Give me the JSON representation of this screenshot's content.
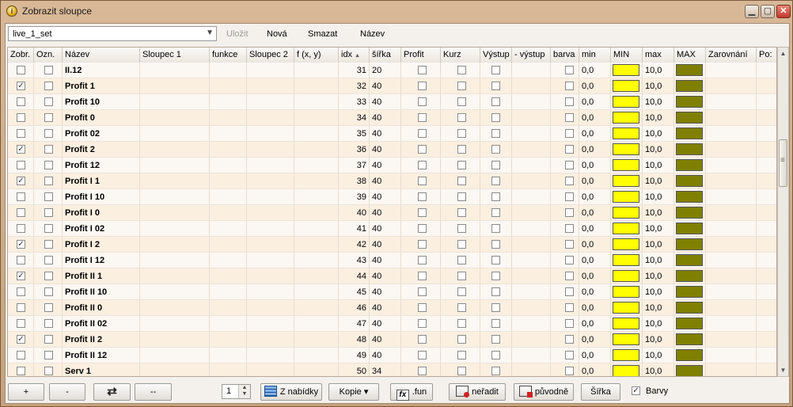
{
  "window": {
    "title": "Zobrazit sloupce",
    "icon": "info-app-icon",
    "controls": {
      "minimize": "▁",
      "maximize": "▢",
      "close": "✕"
    }
  },
  "toolbar": {
    "combo_value": "live_1_set",
    "save_label": "Uložit",
    "new_label": "Nová",
    "delete_label": "Smazat",
    "name_label": "Název"
  },
  "columns": {
    "zobr": "Zobr.",
    "ozn": "Ozn.",
    "nazev": "Název",
    "sloupec1": "Sloupec 1",
    "funkce": "funkce",
    "sloupec2": "Sloupec 2",
    "fxy": "f (x, y)",
    "idx": "idx",
    "sirka": "šířka",
    "profit": "Profit",
    "kurz": "Kurz",
    "vystup": "Výstup",
    "minus_vystup": "- výstup",
    "barva": "barva",
    "min": "min",
    "MIN": "MIN",
    "max": "max",
    "MAX": "MAX",
    "zarovnani": "Zarovnání",
    "poz": "Po:"
  },
  "rows": [
    {
      "zobr": false,
      "ozn": false,
      "nazev": "II.12",
      "idx": "31",
      "sirka": "20",
      "min": "0,0",
      "max": "10,0"
    },
    {
      "zobr": true,
      "ozn": false,
      "nazev": "Profit 1",
      "idx": "32",
      "sirka": "40",
      "min": "0,0",
      "max": "10,0"
    },
    {
      "zobr": false,
      "ozn": false,
      "nazev": "Profit 10",
      "idx": "33",
      "sirka": "40",
      "min": "0,0",
      "max": "10,0"
    },
    {
      "zobr": false,
      "ozn": false,
      "nazev": "Profit 0",
      "idx": "34",
      "sirka": "40",
      "min": "0,0",
      "max": "10,0"
    },
    {
      "zobr": false,
      "ozn": false,
      "nazev": "Profit 02",
      "idx": "35",
      "sirka": "40",
      "min": "0,0",
      "max": "10,0"
    },
    {
      "zobr": true,
      "ozn": false,
      "nazev": "Profit 2",
      "idx": "36",
      "sirka": "40",
      "min": "0,0",
      "max": "10,0"
    },
    {
      "zobr": false,
      "ozn": false,
      "nazev": "Profit 12",
      "idx": "37",
      "sirka": "40",
      "min": "0,0",
      "max": "10,0"
    },
    {
      "zobr": true,
      "ozn": false,
      "nazev": "Profit I 1",
      "idx": "38",
      "sirka": "40",
      "min": "0,0",
      "max": "10,0"
    },
    {
      "zobr": false,
      "ozn": false,
      "nazev": "Profit I 10",
      "idx": "39",
      "sirka": "40",
      "min": "0,0",
      "max": "10,0"
    },
    {
      "zobr": false,
      "ozn": false,
      "nazev": "Profit I 0",
      "idx": "40",
      "sirka": "40",
      "min": "0,0",
      "max": "10,0"
    },
    {
      "zobr": false,
      "ozn": false,
      "nazev": "Profit I 02",
      "idx": "41",
      "sirka": "40",
      "min": "0,0",
      "max": "10,0"
    },
    {
      "zobr": true,
      "ozn": false,
      "nazev": "Profit I 2",
      "idx": "42",
      "sirka": "40",
      "min": "0,0",
      "max": "10,0"
    },
    {
      "zobr": false,
      "ozn": false,
      "nazev": "Profit I 12",
      "idx": "43",
      "sirka": "40",
      "min": "0,0",
      "max": "10,0"
    },
    {
      "zobr": true,
      "ozn": false,
      "nazev": "Profit II 1",
      "idx": "44",
      "sirka": "40",
      "min": "0,0",
      "max": "10,0"
    },
    {
      "zobr": false,
      "ozn": false,
      "nazev": "Profit II 10",
      "idx": "45",
      "sirka": "40",
      "min": "0,0",
      "max": "10,0"
    },
    {
      "zobr": false,
      "ozn": false,
      "nazev": "Profit II 0",
      "idx": "46",
      "sirka": "40",
      "min": "0,0",
      "max": "10,0"
    },
    {
      "zobr": false,
      "ozn": false,
      "nazev": "Profit II 02",
      "idx": "47",
      "sirka": "40",
      "min": "0,0",
      "max": "10,0"
    },
    {
      "zobr": true,
      "ozn": false,
      "nazev": "Profit II 2",
      "idx": "48",
      "sirka": "40",
      "min": "0,0",
      "max": "10,0"
    },
    {
      "zobr": false,
      "ozn": false,
      "nazev": "Profit II 12",
      "idx": "49",
      "sirka": "40",
      "min": "0,0",
      "max": "10,0"
    },
    {
      "zobr": false,
      "ozn": false,
      "nazev": "Serv 1",
      "idx": "50",
      "sirka": "34",
      "min": "0,0",
      "max": "10,0"
    }
  ],
  "colors": {
    "min_color": "#ffff00",
    "max_color": "#808000",
    "row_odd": "#fbefe0",
    "row_even": "#fbf7f2"
  },
  "bottom": {
    "add_label": "+",
    "remove_label": "-",
    "refresh_icon": "refresh-icon",
    "dashes_label": "--",
    "spin_value": "1",
    "from_menu_label": "Z nabídky",
    "copy_label": "Kopie ▾",
    "fun_label": ".fun",
    "no_sort_label": "neřadit",
    "original_label": "původně",
    "width_label": "Šířka",
    "colors_label": "Barvy",
    "colors_checked": true
  }
}
